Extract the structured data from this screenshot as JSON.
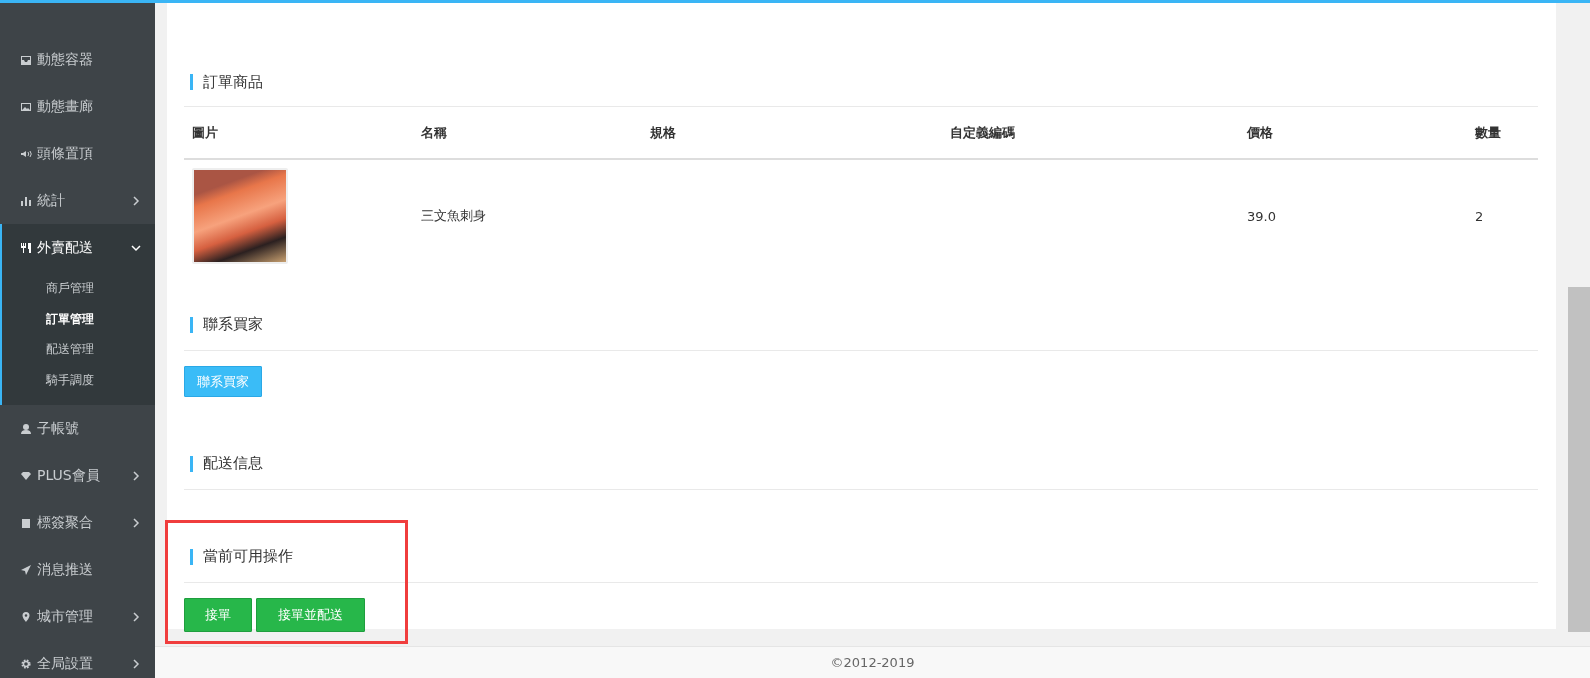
{
  "sidebar": {
    "items": [
      {
        "label": "動態容器"
      },
      {
        "label": "動態畫廊"
      },
      {
        "label": "頭條置頂"
      },
      {
        "label": "統計",
        "expanded": false
      },
      {
        "label": "外賣配送",
        "expanded": true,
        "children": [
          {
            "label": "商戶管理",
            "selected": false
          },
          {
            "label": "訂單管理",
            "selected": true
          },
          {
            "label": "配送管理",
            "selected": false
          },
          {
            "label": "騎手調度",
            "selected": false
          }
        ]
      },
      {
        "label": "子帳號"
      },
      {
        "label": "PLUS會員",
        "expanded": false
      },
      {
        "label": "標簽聚合",
        "expanded": false
      },
      {
        "label": "消息推送"
      },
      {
        "label": "城市管理",
        "expanded": false
      },
      {
        "label": "全局設置",
        "expanded": false
      }
    ]
  },
  "sections": [
    {
      "title": "訂單商品",
      "kind": "table",
      "table": {
        "columns": [
          "圖片",
          "名稱",
          "規格",
          "自定義編碼",
          "價格",
          "數量"
        ],
        "rows": [
          [
            "",
            "三文魚刺身",
            "",
            "",
            "39.0",
            "2"
          ]
        ]
      }
    },
    {
      "title": "聯系買家",
      "kind": "buttons",
      "buttons": [
        {
          "label": "聯系買家",
          "kind": "info"
        }
      ]
    },
    {
      "title": "配送信息",
      "kind": "empty"
    },
    {
      "title": "當前可用操作",
      "kind": "buttons",
      "highlighted": true,
      "buttons": [
        {
          "label": "接單",
          "kind": "success"
        },
        {
          "label": "接單並配送",
          "kind": "success"
        }
      ]
    }
  ],
  "footer": "©2012-2019"
}
